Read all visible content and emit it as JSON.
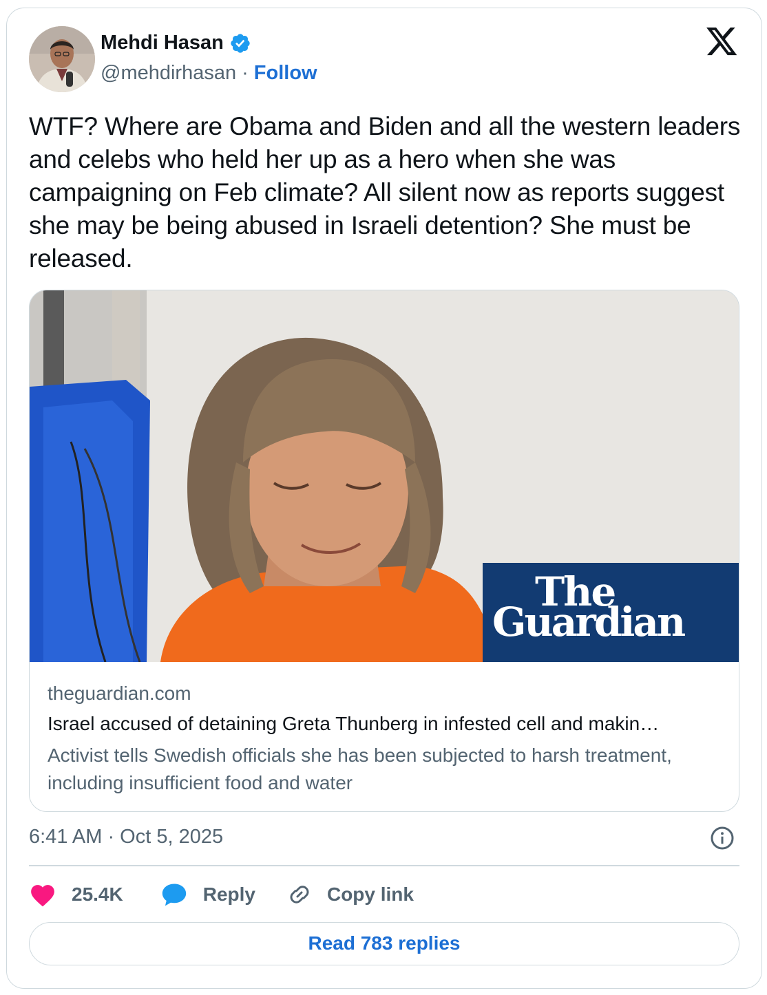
{
  "author": {
    "name": "Mehdi Hasan",
    "handle": "@mehdirhasan",
    "separator": "·",
    "follow_label": "Follow",
    "verified_color": "#1d9bf0"
  },
  "platform_icon": "x-logo-icon",
  "tweet": {
    "text": "WTF? Where are Obama and Biden and all the western leaders and celebs who held her up as a hero when she was campaigning on Feb climate? All silent now as reports suggest she may be being abused in Israeli detention? She must be released."
  },
  "link_card": {
    "brand_line1": "The",
    "brand_line2": "Guardian",
    "brand_color": "#123b72",
    "domain": "theguardian.com",
    "title": "Israel accused of detaining Greta Thunberg in infested cell and makin…",
    "description": "Activist tells Swedish officials she has been subjected to harsh treatment, including insufficient food and water"
  },
  "timestamp": "6:41 AM · Oct 5, 2025",
  "actions": {
    "likes": "25.4K",
    "reply_label": "Reply",
    "copy_link_label": "Copy link",
    "like_color": "#f91880",
    "reply_color": "#1d9bf0"
  },
  "read_replies_label": "Read 783 replies"
}
